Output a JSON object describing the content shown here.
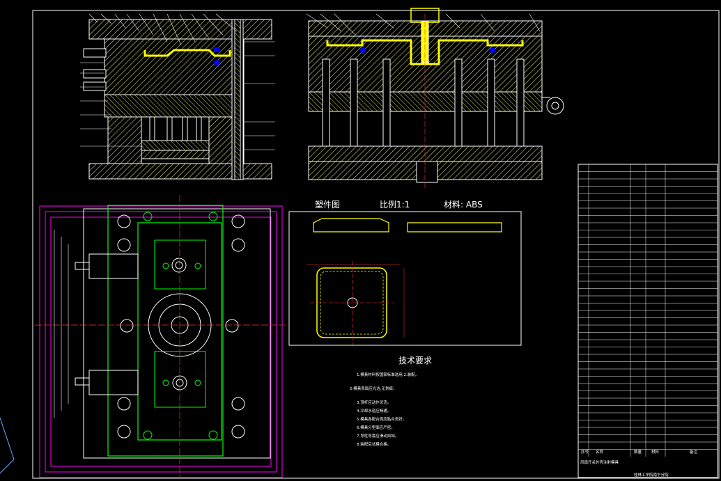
{
  "part_drawing": {
    "title": "塑件图",
    "scale": "比例1:1",
    "material": "材料: ABS"
  },
  "tech_requirements": {
    "heading": "技术要求",
    "lines": [
      "1.模具材料按国家标准选用,2.装配。",
      "2.模具表面应光洁,无划痕。",
      "3.顶杆应动作灵活。",
      "4.冷却水道应畅通。",
      "5.模具各配合面应贴合良好。",
      "6.模具分型面应严密。",
      "7.导柱导套应滑动自如。",
      "8.装配后试模合格。"
    ]
  },
  "title_block": {
    "rows": [
      [
        "",
        "",
        "",
        "",
        ""
      ],
      [
        "",
        "",
        "",
        "",
        ""
      ],
      [
        "",
        "",
        "",
        "",
        ""
      ],
      [
        "",
        "",
        "",
        "",
        ""
      ],
      [
        "",
        "",
        "",
        "",
        ""
      ],
      [
        "",
        "",
        "",
        "",
        ""
      ],
      [
        "",
        "",
        "",
        "",
        ""
      ],
      [
        "",
        "",
        "",
        "",
        ""
      ],
      [
        "",
        "",
        "",
        "",
        ""
      ],
      [
        "",
        "",
        "",
        "",
        ""
      ]
    ],
    "name": "风扇开关外壳注射模具",
    "school": "桂林工学院南宁分院",
    "footer_labels": [
      "序号",
      "名称",
      "数量",
      "材料",
      "备注"
    ]
  },
  "colors": {
    "hatch": "#e6e680",
    "plastic": "#ffff00",
    "outline_green": "#00ff00",
    "outline_magenta": "#ff00ff",
    "frame": "#ffffff",
    "dim": "#ff3030"
  }
}
